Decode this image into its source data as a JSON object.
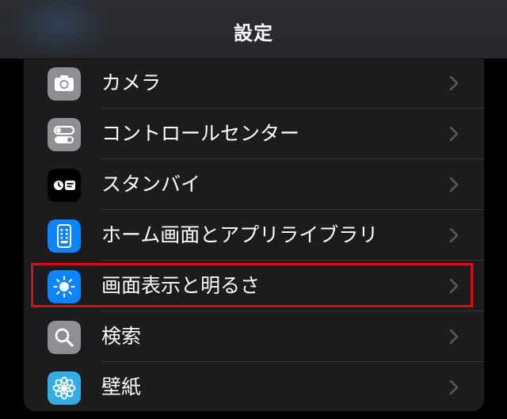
{
  "header": {
    "title": "設定"
  },
  "settings": {
    "items": [
      {
        "label": "カメラ",
        "icon": "camera-icon",
        "icon_bg": "#8e8e93"
      },
      {
        "label": "コントロールセンター",
        "icon": "toggles-icon",
        "icon_bg": "#8e8e93"
      },
      {
        "label": "スタンバイ",
        "icon": "standby-icon",
        "icon_bg": "#000000"
      },
      {
        "label": "ホーム画面とアプリライブラリ",
        "icon": "home-screen-icon",
        "icon_bg": "#0a84ff"
      },
      {
        "label": "画面表示と明るさ",
        "icon": "brightness-icon",
        "icon_bg": "#0a84ff"
      },
      {
        "label": "検索",
        "icon": "search-icon",
        "icon_bg": "#8e8e93"
      },
      {
        "label": "壁紙",
        "icon": "wallpaper-icon",
        "icon_bg": "#32ade6"
      }
    ],
    "highlighted_item": "画面表示と明るさ",
    "highlight_color": "#d40f0f"
  }
}
